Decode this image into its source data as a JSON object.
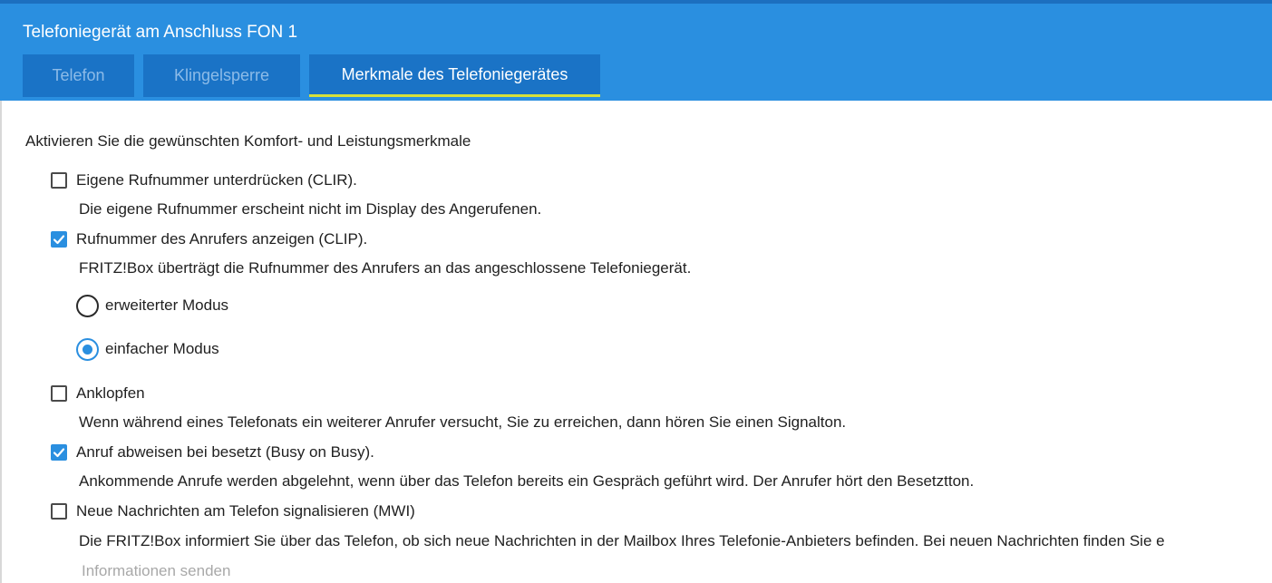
{
  "header": {
    "title": "Telefoniegerät am Anschluss FON 1",
    "tabs": [
      {
        "label": "Telefon",
        "active": false
      },
      {
        "label": "Klingelsperre",
        "active": false
      },
      {
        "label": "Merkmale des Telefoniegerätes",
        "active": true
      }
    ]
  },
  "main": {
    "intro": "Aktivieren Sie die gewünschten Komfort- und Leistungsmerkmale",
    "options": [
      {
        "label": "Eigene Rufnummer unterdrücken (CLIR).",
        "checked": false,
        "description": "Die eigene Rufnummer erscheint nicht im Display des Angerufenen."
      },
      {
        "label": "Rufnummer des Anrufers anzeigen (CLIP).",
        "checked": true,
        "description": "FRITZ!Box überträgt die Rufnummer des Anrufers an das angeschlossene Telefoniegerät.",
        "radios": [
          {
            "label": "erweiterter Modus",
            "selected": false
          },
          {
            "label": "einfacher Modus",
            "selected": true
          }
        ]
      },
      {
        "label": "Anklopfen",
        "checked": false,
        "description": "Wenn während eines Telefonats ein weiterer Anrufer versucht, Sie zu erreichen, dann hören Sie einen Signalton."
      },
      {
        "label": "Anruf abweisen bei besetzt (Busy on Busy).",
        "checked": true,
        "description": "Ankommende Anrufe werden abgelehnt, wenn über das Telefon bereits ein Gespräch geführt wird. Der Anrufer hört den Besetztton."
      },
      {
        "label": "Neue Nachrichten am Telefon signalisieren (MWI)",
        "checked": false,
        "description": "Die FRITZ!Box informiert Sie über das Telefon, ob sich neue Nachrichten in der Mailbox Ihres Telefonie-Anbieters befinden. Bei neuen Nachrichten finden Sie e"
      }
    ],
    "send_info_label": "Informationen senden"
  },
  "colors": {
    "header_bg": "#2a8fe0",
    "tab_bg": "#1a73c6",
    "tab_active_underline": "#d6e03a",
    "accent": "#2a8fe0"
  }
}
